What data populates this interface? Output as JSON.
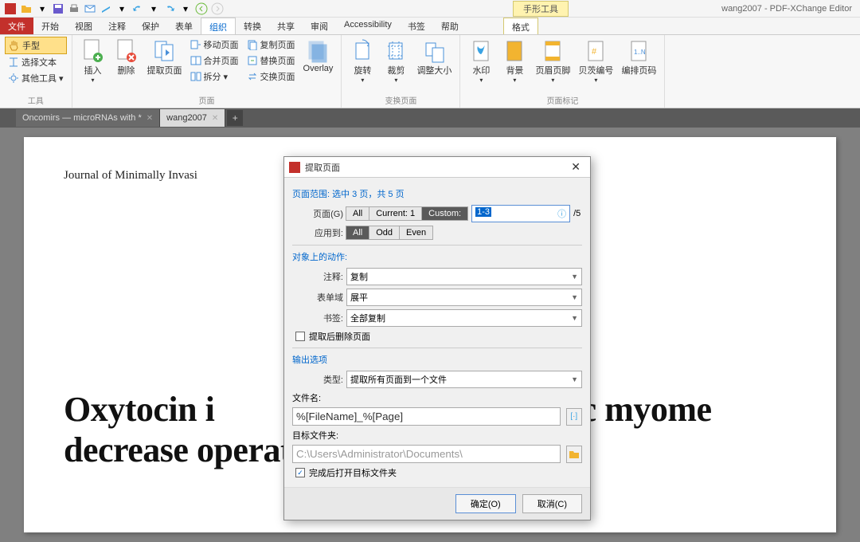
{
  "titlebar": {
    "context_tab": "手形工具",
    "window_title": "wang2007 - PDF-XChange Editor"
  },
  "menubar": {
    "file": "文件",
    "tabs": [
      "开始",
      "视图",
      "注释",
      "保护",
      "表单",
      "组织",
      "转换",
      "共享",
      "审阅",
      "Accessibility",
      "书签",
      "帮助"
    ],
    "active": "组织",
    "ctx": "格式"
  },
  "ribbon": {
    "tools_group": {
      "hand": "手型",
      "select": "选择文本",
      "other": "其他工具",
      "label": "工具"
    },
    "page_group": {
      "insert": "插入",
      "delete": "删除",
      "extract": "提取页面",
      "move": "移动页面",
      "merge": "合并页面",
      "split": "拆分",
      "copy": "复制页面",
      "replace": "替换页面",
      "swap": "交换页面",
      "overlay": "Overlay",
      "label": "页面"
    },
    "transform_group": {
      "rotate": "旋转",
      "crop": "裁剪",
      "resize": "调整大小",
      "label": "变换页面"
    },
    "mark_group": {
      "watermark": "水印",
      "background": "背景",
      "header": "页眉页脚",
      "bates": "贝茨编号",
      "number": "编排页码",
      "label": "页面标记"
    }
  },
  "doctabs": {
    "tab1": "Oncomirs — microRNAs with *",
    "tab2": "wang2007"
  },
  "document": {
    "journal": "Journal of Minimally Invasi",
    "title_line_fragment": "Oxytocin i                                   scopic myome",
    "title_line2": "decrease operative blood loss"
  },
  "dialog": {
    "title": "提取页面",
    "sec_range": "页面范围: 选中 3 页，共 5 页",
    "lbl_page": "页面(G)",
    "range_all": "All",
    "range_current": "Current: 1",
    "range_custom": "Custom:",
    "range_value": "1-3",
    "range_total": "/5",
    "lbl_apply": "应用到:",
    "apply_all": "All",
    "apply_odd": "Odd",
    "apply_even": "Even",
    "sec_actions": "对象上的动作:",
    "lbl_comments": "注释:",
    "val_comments": "复制",
    "lbl_forms": "表单域",
    "val_forms": "展平",
    "lbl_bookmarks": "书签:",
    "val_bookmarks": "全部复制",
    "chk_delete": "提取后删除页面",
    "sec_output": "输出选项",
    "lbl_type": "类型:",
    "val_type": "提取所有页面到一个文件",
    "lbl_filename": "文件名:",
    "val_filename": "%[FileName]_%[Page]",
    "lbl_folder": "目标文件夹:",
    "val_folder": "C:\\Users\\Administrator\\Documents\\",
    "chk_open": "完成后打开目标文件夹",
    "btn_ok": "确定(O)",
    "btn_cancel": "取消(C)"
  }
}
